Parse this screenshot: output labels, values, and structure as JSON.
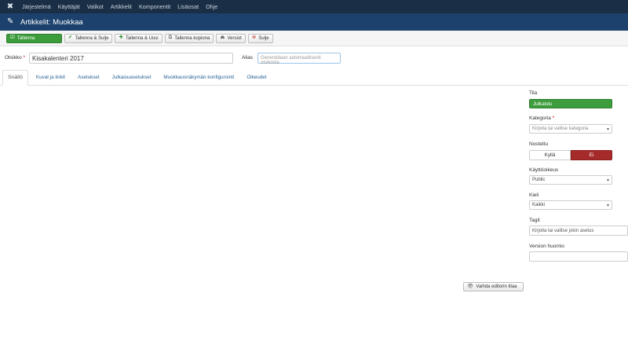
{
  "topnav": {
    "items": [
      "Järjestelmä",
      "Käyttäjät",
      "Valikot",
      "Artikkelit",
      "Komponentit",
      "Lisäosat",
      "Ohje"
    ]
  },
  "header": {
    "title": "Artikkelit: Muokkaa"
  },
  "toolbar": {
    "save": "Tallenna",
    "save_close": "Tallenna & Sulje",
    "save_new": "Tallenna & Uusi",
    "save_copy": "Tallenna kopiona",
    "versions": "Versiot",
    "close": "Sulje"
  },
  "form": {
    "title_label": "Otsikko",
    "title_required": "*",
    "title_value": "Kisakalenteri 2017",
    "alias_label": "Alias",
    "alias_placeholder": "Generoidaan automaattisesti otsikosta"
  },
  "tabs": [
    "Sisältö",
    "Kuvat ja linkit",
    "Asetukset",
    "Julkaisuasetukset",
    "Muokkausnäkymän konfigurointi",
    "Oikeudet"
  ],
  "editor": {
    "toggle_label": "Vaihda editorin tilaa"
  },
  "sidebar": {
    "status_label": "Tila",
    "status_value": "Julkaistu",
    "category_label": "Kategoria",
    "category_required": "*",
    "category_placeholder": "Kirjoita tai valitse kategoria",
    "featured_label": "Nostettu",
    "featured_yes": "Kyllä",
    "featured_no": "Ei",
    "access_label": "Käyttöoikeus",
    "access_value": "Public",
    "language_label": "Kieli",
    "language_value": "Kaikki",
    "tags_label": "Tagit",
    "tags_placeholder": "Kirjoita tai valitse jokin asetus",
    "version_note_label": "Version huomio",
    "version_note_value": ""
  },
  "colors": {
    "topnav": "#1a2f45",
    "titlebar": "#1b416c",
    "success": "#3d9d3d",
    "danger": "#a52a2a"
  }
}
